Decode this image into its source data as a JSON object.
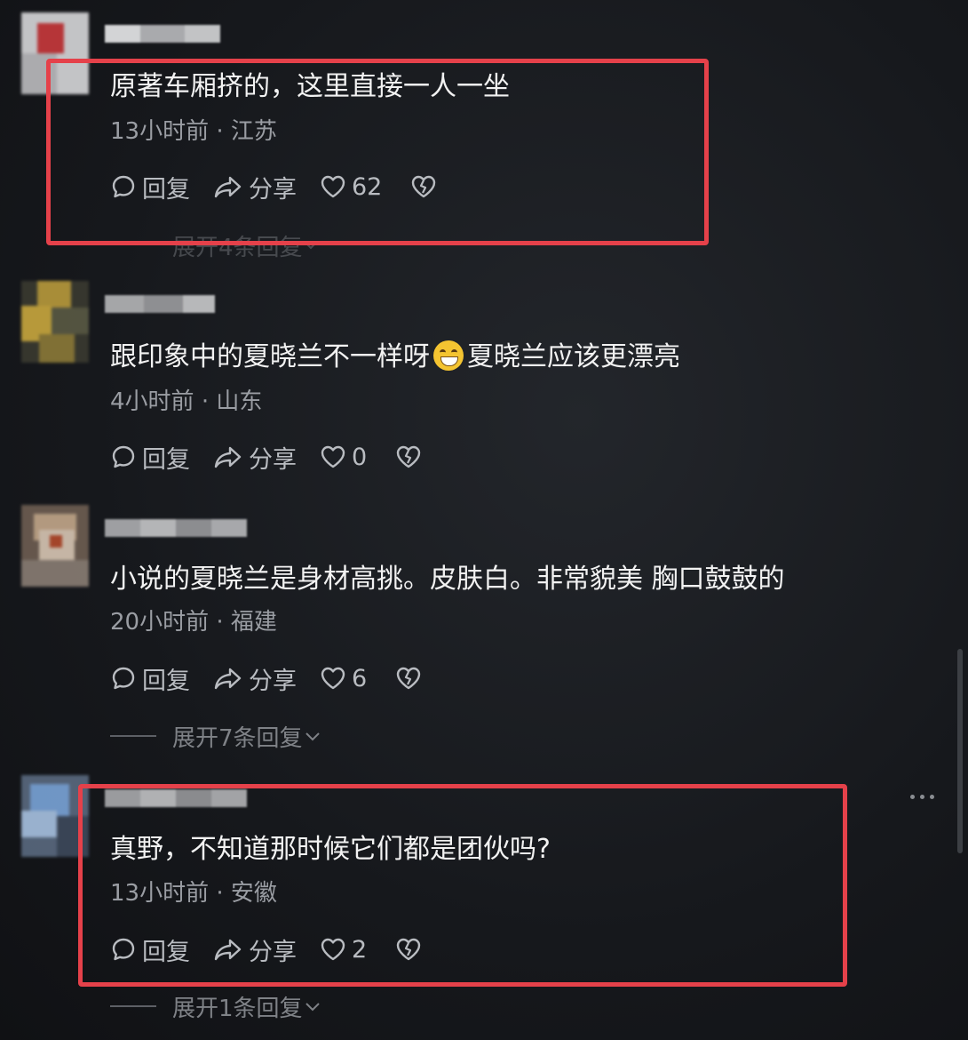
{
  "comments": [
    {
      "text": "原著车厢挤的，这里直接一人一坐",
      "time": "13小时前",
      "sep": "·",
      "location": "江苏",
      "reply_label": "回复",
      "share_label": "分享",
      "likes": "62",
      "expand": "展开4条回复"
    },
    {
      "text_a": "跟印象中的夏晓兰不一样呀",
      "text_b": "夏晓兰应该更漂亮",
      "time": "4小时前",
      "sep": "·",
      "location": "山东",
      "reply_label": "回复",
      "share_label": "分享",
      "likes": "0"
    },
    {
      "text": "小说的夏晓兰是身材高挑。皮肤白。非常貌美 胸口鼓鼓的",
      "time": "20小时前",
      "sep": "·",
      "location": "福建",
      "reply_label": "回复",
      "share_label": "分享",
      "likes": "6",
      "expand": "展开7条回复"
    },
    {
      "text": "真野，不知道那时候它们都是团伙吗?",
      "time": "13小时前",
      "sep": "·",
      "location": "安徽",
      "reply_label": "回复",
      "share_label": "分享",
      "likes": "2",
      "expand": "展开1条回复"
    }
  ],
  "icons": {
    "reply": "comment-bubble-icon",
    "share": "share-arrow-icon",
    "like": "heart-icon",
    "dislike": "broken-heart-icon",
    "more": "more-dots-icon",
    "emoji": "grinning-sweat-emoji"
  },
  "colors": {
    "highlight": "#e5414a",
    "background": "#16181c",
    "text": "#f2f2f2",
    "meta": "#9a9da3"
  }
}
